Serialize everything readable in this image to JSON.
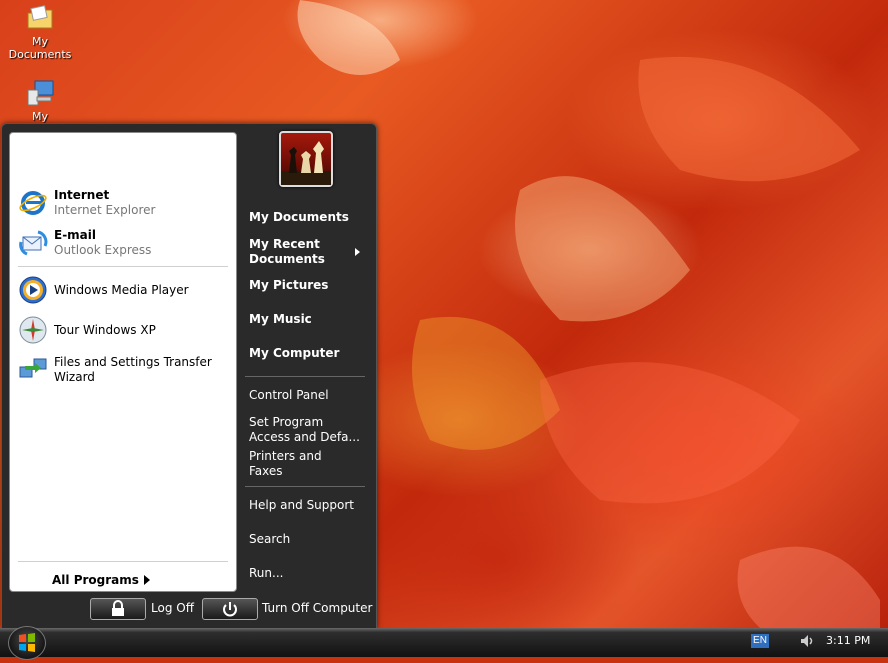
{
  "desktop": {
    "icons": [
      {
        "label_line1": "My",
        "label_line2": "Documents",
        "icon": "folder-documents-icon"
      },
      {
        "label": "My Computer",
        "icon": "computer-icon"
      }
    ]
  },
  "start_menu": {
    "pinned": [
      {
        "title": "Internet",
        "subtitle": "Internet Explorer",
        "icon": "internet-explorer-icon"
      },
      {
        "title": "E-mail",
        "subtitle": "Outlook Express",
        "icon": "outlook-express-icon"
      }
    ],
    "recent": [
      {
        "label": "Windows Media Player",
        "icon": "media-player-icon"
      },
      {
        "label": "Tour Windows XP",
        "icon": "tour-windows-icon"
      },
      {
        "label_line1": "Files and Settings Transfer",
        "label_line2": "Wizard",
        "icon": "transfer-wizard-icon"
      }
    ],
    "all_programs": "All Programs",
    "right": {
      "my_documents": "My Documents",
      "my_recent_1": "My Recent",
      "my_recent_2": "Documents",
      "my_pictures": "My Pictures",
      "my_music": "My Music",
      "my_computer": "My Computer",
      "control_panel": "Control Panel",
      "set_program_1": "Set Program",
      "set_program_2": "Access and Defa...",
      "printers_1": "Printers and",
      "printers_2": "Faxes",
      "help": "Help and Support",
      "search": "Search",
      "run": "Run..."
    },
    "log_off": "Log Off",
    "turn_off": "Turn Off Computer"
  },
  "taskbar": {
    "language": "EN",
    "clock": "3:11 PM"
  },
  "colors": {
    "accent": "#2f6fbf",
    "menu_dark": "#2a2a2a"
  }
}
